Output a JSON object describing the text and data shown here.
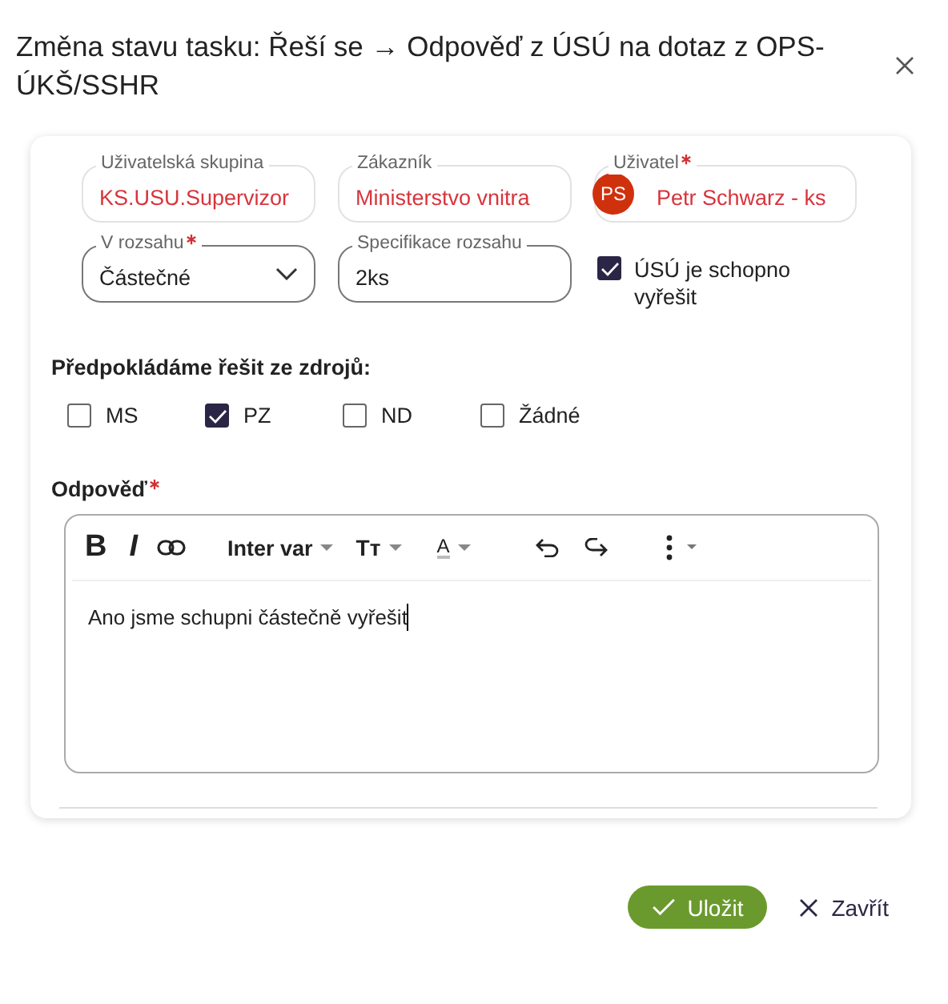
{
  "dialog": {
    "title": "Změna stavu tasku: Řeší se → Odpověď z ÚSÚ na dotaz z OPS-ÚKŠ/SSHR"
  },
  "fields_row1": [
    {
      "kind": "text",
      "label": "Uživatelská skupina",
      "value": "KS.USU.Supervizor",
      "required": false
    },
    {
      "kind": "text",
      "label": "Zákazník",
      "value": "Ministerstvo vnitra",
      "required": false
    },
    {
      "kind": "user",
      "label": "Uživatel",
      "value": "Petr Schwarz - ks",
      "initials": "PS",
      "required": true
    }
  ],
  "scope": {
    "label": "V rozsahu",
    "value": "Částečné",
    "required": true
  },
  "scope_spec": {
    "label": "Specifikace rozsahu",
    "value": "2ks"
  },
  "able": {
    "label": "ÚSÚ je schopno vyřešit",
    "checked": true
  },
  "sources": {
    "heading": "Předpokládáme řešit ze zdrojů:",
    "options": [
      {
        "label": "MS",
        "checked": false
      },
      {
        "label": "PZ",
        "checked": true
      },
      {
        "label": "ND",
        "checked": false
      },
      {
        "label": "Žádné",
        "checked": false
      }
    ]
  },
  "answer": {
    "label": "Odpověď",
    "required": true,
    "text": "Ano jsme schupni částečně vyřešit",
    "toolbar": [
      {
        "kind": "bold",
        "label": "B"
      },
      {
        "kind": "italic",
        "label": "I"
      },
      {
        "kind": "link"
      },
      {
        "kind": "font",
        "label": "Inter var"
      },
      {
        "kind": "size",
        "label": "Tт"
      },
      {
        "kind": "color",
        "label": "A"
      },
      {
        "kind": "undo"
      },
      {
        "kind": "redo"
      },
      {
        "kind": "more"
      }
    ]
  },
  "buttons": [
    {
      "kind": "primary",
      "label": "Uložit"
    },
    {
      "kind": "close",
      "label": "Zavřít"
    }
  ]
}
